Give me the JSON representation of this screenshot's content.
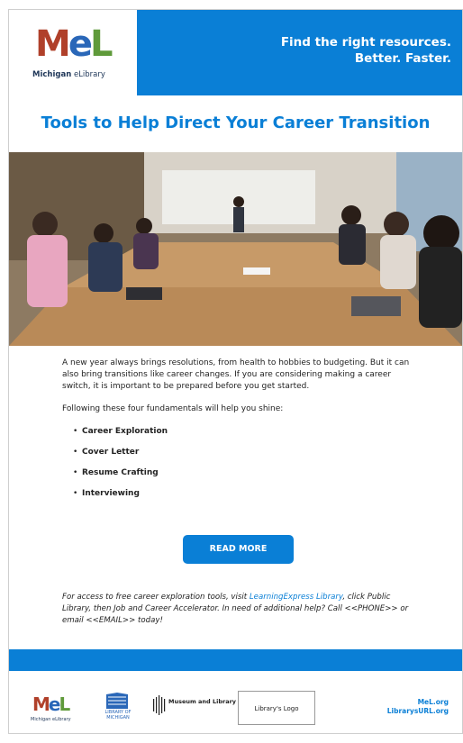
{
  "header": {
    "logo_letters": "MeL",
    "logo_sub_bold": "Michigan",
    "logo_sub_rest": " eLibrary",
    "tagline_line1": "Find the right resources.",
    "tagline_line2": "Better. Faster."
  },
  "title": "Tools to Help Direct Your Career Transition",
  "body": {
    "para1": "A new year always brings resolutions, from health to hobbies to budgeting. But it can also bring transitions like career changes. If you are considering making a career switch, it is important to be prepared before you get started.",
    "para2": "Following these four fundamentals will help you shine:",
    "bullets": [
      "Career Exploration",
      "Cover Letter",
      "Resume Crafting",
      "Interviewing"
    ]
  },
  "cta": {
    "label": "READ MORE"
  },
  "note": {
    "prefix": "For access to free career exploration tools, visit ",
    "link": "LearningExpress Library",
    "suffix": ", click Public Library, then Job and Career Accelerator. In need of additional help? Call <<PHONE>> or email <<EMAIL>> today!"
  },
  "footer": {
    "mel_letters": "MeL",
    "mel_sub": "Michigan eLibrary",
    "lom_line1": "LIBRARY OF",
    "lom_line2": "MICHIGAN",
    "imls": "Museum and Library",
    "library_logo": "Library's Logo",
    "link1": "MeL.org",
    "link2": "LibrarysURL.org"
  },
  "colors": {
    "brand_blue": "#0a7fd6",
    "mel_red": "#b0402a",
    "mel_blue": "#2a67b8",
    "mel_green": "#5f9a3a"
  }
}
